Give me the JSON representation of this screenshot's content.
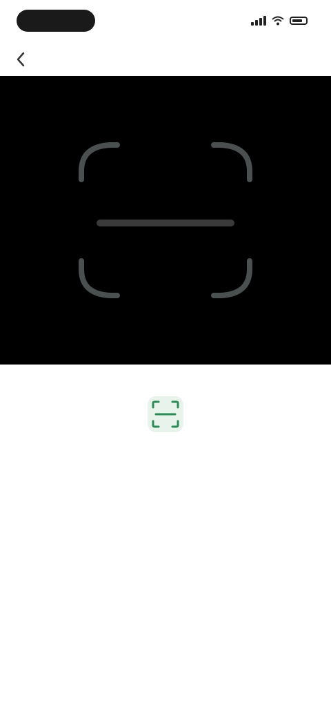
{
  "status_bar": {
    "time": "",
    "icons": [
      "signal-icon",
      "wifi-icon",
      "battery-icon"
    ]
  },
  "header": {
    "title": "",
    "back_icon": "chevron-left-icon"
  },
  "camera": {
    "background": "#000000",
    "frame_color": "#4a4f4f"
  },
  "prompt": {
    "icon": "qr-scan-icon",
    "icon_color": "#2e8b57",
    "instruction": ""
  }
}
